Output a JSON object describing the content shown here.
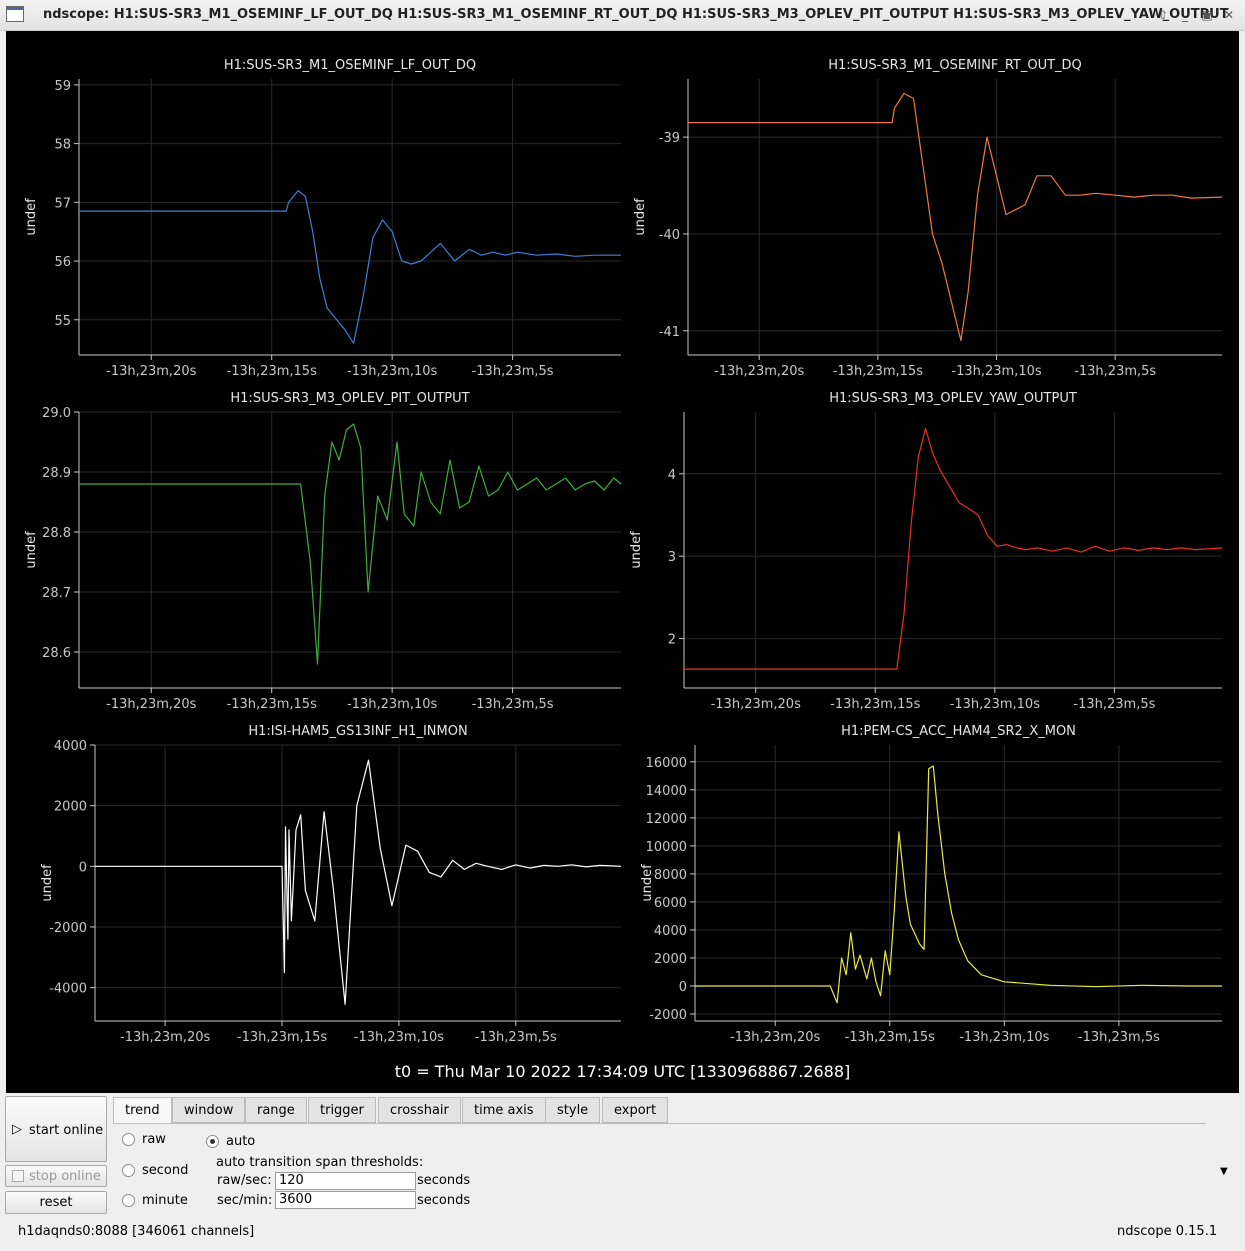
{
  "window": {
    "title": "ndscope: H1:SUS-SR3_M1_OSEMINF_LF_OUT_DQ H1:SUS-SR3_M1_OSEMINF_RT_OUT_DQ H1:SUS-SR3_M3_OPLEV_PIT_OUTPUT H1:SUS-SR3_M3_OPLEV_YAW_OUTPUT",
    "controls": [
      "up-arrow-icon",
      "minimize-icon",
      "maximize-icon",
      "close-icon"
    ]
  },
  "plots": [
    {
      "title": "H1:SUS-SR3_M1_OSEMINF_LF_OUT_DQ",
      "ylabel": "undef",
      "color": "#3f7fd8",
      "yticks": [
        "55",
        "56",
        "57",
        "58",
        "59"
      ],
      "ytick_values": [
        55,
        56,
        57,
        58,
        59
      ],
      "ylim": [
        54.4,
        59.1
      ],
      "xticks": [
        "-13h,23m,20s",
        "-13h,23m,15s",
        "-13h,23m,10s",
        "-13h,23m,5s"
      ]
    },
    {
      "title": "H1:SUS-SR3_M1_OSEMINF_RT_OUT_DQ",
      "ylabel": "undef",
      "color": "#f07a3a",
      "yticks": [
        "-41",
        "-40",
        "-39"
      ],
      "ytick_values": [
        -41,
        -40,
        -39
      ],
      "ylim": [
        -41.25,
        -38.4
      ],
      "xticks": [
        "-13h,23m,20s",
        "-13h,23m,15s",
        "-13h,23m,10s",
        "-13h,23m,5s"
      ]
    },
    {
      "title": "H1:SUS-SR3_M3_OPLEV_PIT_OUTPUT",
      "ylabel": "undef",
      "color": "#3fae3f",
      "yticks": [
        "28.6",
        "28.7",
        "28.8",
        "28.9",
        "29.0"
      ],
      "ytick_values": [
        28.6,
        28.7,
        28.8,
        28.9,
        29.0
      ],
      "ylim": [
        28.54,
        29.0
      ],
      "xticks": [
        "-13h,23m,20s",
        "-13h,23m,15s",
        "-13h,23m,10s",
        "-13h,23m,5s"
      ]
    },
    {
      "title": "H1:SUS-SR3_M3_OPLEV_YAW_OUTPUT",
      "ylabel": "undef",
      "color": "#e8302a",
      "yticks": [
        "2",
        "3",
        "4"
      ],
      "ytick_values": [
        2,
        3,
        4
      ],
      "ylim": [
        1.4,
        4.75
      ],
      "xticks": [
        "-13h,23m,20s",
        "-13h,23m,15s",
        "-13h,23m,10s",
        "-13h,23m,5s"
      ]
    },
    {
      "title": "H1:ISI-HAM5_GS13INF_H1_INMON",
      "ylabel": "undef",
      "color": "#ffffff",
      "yticks": [
        "-4000",
        "-2000",
        "0",
        "2000",
        "4000"
      ],
      "ytick_values": [
        -4000,
        -2000,
        0,
        2000,
        4000
      ],
      "ylim": [
        -5100,
        4000
      ],
      "xticks": [
        "-13h,23m,20s",
        "-13h,23m,15s",
        "-13h,23m,10s",
        "-13h,23m,5s"
      ]
    },
    {
      "title": "H1:PEM-CS_ACC_HAM4_SR2_X_MON",
      "ylabel": "undef",
      "color": "#e8e84a",
      "yticks": [
        "-2000",
        "0",
        "2000",
        "4000",
        "6000",
        "8000",
        "10000",
        "12000",
        "14000",
        "16000"
      ],
      "ytick_values": [
        -2000,
        0,
        2000,
        4000,
        6000,
        8000,
        10000,
        12000,
        14000,
        16000
      ],
      "ylim": [
        -2500,
        17200
      ],
      "xticks": [
        "-13h,23m,20s",
        "-13h,23m,15s",
        "-13h,23m,10s",
        "-13h,23m,5s"
      ]
    }
  ],
  "chart_data": [
    {
      "type": "line",
      "title": "H1:SUS-SR3_M1_OSEMINF_LF_OUT_DQ",
      "ylabel": "undef",
      "xlim": [
        -23.0,
        -0.5
      ],
      "ylim": [
        54.4,
        59.1
      ],
      "series": [
        {
          "values_x": [
            -23,
            -14.4,
            -14.3,
            -13.9,
            -13.6,
            -13.3,
            -13.0,
            -12.7,
            -12.4,
            -12.0,
            -11.6,
            -11.2,
            -10.8,
            -10.4,
            -10.0,
            -9.6,
            -9.2,
            -8.8,
            -8.4,
            -8.0,
            -7.4,
            -6.8,
            -6.3,
            -5.8,
            -5.3,
            -4.8,
            -4.0,
            -3.2,
            -2.4,
            -1.6,
            -0.5
          ],
          "values_y": [
            56.85,
            56.85,
            57.0,
            57.2,
            57.1,
            56.5,
            55.7,
            55.2,
            55.05,
            54.85,
            54.6,
            55.4,
            56.4,
            56.7,
            56.5,
            56.0,
            55.95,
            56.0,
            56.15,
            56.3,
            56.0,
            56.2,
            56.1,
            56.15,
            56.1,
            56.15,
            56.1,
            56.12,
            56.08,
            56.1,
            56.1
          ]
        }
      ]
    },
    {
      "type": "line",
      "title": "H1:SUS-SR3_M1_OSEMINF_RT_OUT_DQ",
      "ylabel": "undef",
      "xlim": [
        -23.0,
        -0.5
      ],
      "ylim": [
        -41.25,
        -38.4
      ],
      "series": [
        {
          "values_x": [
            -23,
            -14.4,
            -14.3,
            -13.9,
            -13.5,
            -13.1,
            -12.7,
            -12.3,
            -11.9,
            -11.5,
            -11.2,
            -10.8,
            -10.4,
            -10.0,
            -9.6,
            -9.2,
            -8.8,
            -8.3,
            -7.7,
            -7.1,
            -6.5,
            -5.8,
            -5.0,
            -4.2,
            -3.4,
            -2.6,
            -1.8,
            -0.5
          ],
          "values_y": [
            -38.85,
            -38.85,
            -38.7,
            -38.55,
            -38.6,
            -39.3,
            -40.0,
            -40.3,
            -40.7,
            -41.1,
            -40.6,
            -39.6,
            -39.0,
            -39.4,
            -39.8,
            -39.75,
            -39.7,
            -39.4,
            -39.4,
            -39.6,
            -39.6,
            -39.58,
            -39.6,
            -39.62,
            -39.6,
            -39.6,
            -39.63,
            -39.62
          ]
        }
      ]
    },
    {
      "type": "line",
      "title": "H1:SUS-SR3_M3_OPLEV_PIT_OUTPUT",
      "ylabel": "undef",
      "xlim": [
        -23.0,
        -0.5
      ],
      "ylim": [
        28.54,
        29.0
      ],
      "series": [
        {
          "values_x": [
            -23,
            -13.8,
            -13.4,
            -13.1,
            -12.8,
            -12.5,
            -12.2,
            -11.9,
            -11.6,
            -11.3,
            -11.0,
            -10.6,
            -10.2,
            -9.8,
            -9.5,
            -9.1,
            -8.8,
            -8.4,
            -8.0,
            -7.6,
            -7.2,
            -6.8,
            -6.4,
            -6.0,
            -5.6,
            -5.2,
            -4.8,
            -4.4,
            -4.0,
            -3.6,
            -3.2,
            -2.8,
            -2.4,
            -2.0,
            -1.6,
            -1.2,
            -0.8,
            -0.5
          ],
          "values_y": [
            28.88,
            28.88,
            28.75,
            28.58,
            28.86,
            28.95,
            28.92,
            28.97,
            28.98,
            28.94,
            28.7,
            28.86,
            28.82,
            28.95,
            28.83,
            28.81,
            28.9,
            28.85,
            28.83,
            28.92,
            28.84,
            28.85,
            28.91,
            28.86,
            28.87,
            28.9,
            28.87,
            28.88,
            28.89,
            28.87,
            28.88,
            28.89,
            28.87,
            28.88,
            28.885,
            28.87,
            28.89,
            28.88
          ]
        }
      ]
    },
    {
      "type": "line",
      "title": "H1:SUS-SR3_M3_OPLEV_YAW_OUTPUT",
      "ylabel": "undef",
      "xlim": [
        -23.0,
        -0.5
      ],
      "ylim": [
        1.4,
        4.75
      ],
      "series": [
        {
          "values_x": [
            -23,
            -14.1,
            -13.8,
            -13.5,
            -13.2,
            -12.9,
            -12.6,
            -12.3,
            -11.9,
            -11.5,
            -11.1,
            -10.7,
            -10.3,
            -9.9,
            -9.5,
            -9.1,
            -8.7,
            -8.2,
            -7.6,
            -7.0,
            -6.4,
            -5.8,
            -5.2,
            -4.6,
            -4.0,
            -3.4,
            -2.8,
            -2.2,
            -1.6,
            -0.5
          ],
          "values_y": [
            1.63,
            1.63,
            2.3,
            3.4,
            4.2,
            4.55,
            4.25,
            4.05,
            3.85,
            3.65,
            3.58,
            3.5,
            3.25,
            3.12,
            3.14,
            3.1,
            3.08,
            3.1,
            3.06,
            3.1,
            3.05,
            3.12,
            3.06,
            3.1,
            3.07,
            3.1,
            3.08,
            3.1,
            3.08,
            3.1
          ]
        }
      ]
    },
    {
      "type": "line",
      "title": "H1:ISI-HAM5_GS13INF_H1_INMON",
      "ylabel": "undef",
      "xlim": [
        -23.0,
        -0.5
      ],
      "ylim": [
        -5100,
        4000
      ],
      "series": [
        {
          "values_x": [
            -23,
            -15.0,
            -14.9,
            -14.85,
            -14.75,
            -14.7,
            -14.6,
            -14.4,
            -14.2,
            -14.0,
            -13.6,
            -13.2,
            -12.8,
            -12.3,
            -11.8,
            -11.3,
            -10.8,
            -10.3,
            -9.7,
            -9.2,
            -8.7,
            -8.2,
            -7.7,
            -7.2,
            -6.7,
            -6.2,
            -5.6,
            -5.0,
            -4.4,
            -3.8,
            -3.2,
            -2.6,
            -2.0,
            -1.4,
            -0.5
          ],
          "values_y": [
            0,
            0,
            -3500,
            1300,
            -2400,
            1200,
            -1800,
            1200,
            1700,
            -800,
            -1800,
            1800,
            -800,
            -4550,
            2000,
            3500,
            600,
            -1300,
            700,
            500,
            -200,
            -350,
            200,
            -100,
            100,
            0,
            -100,
            50,
            -60,
            30,
            0,
            50,
            -20,
            30,
            0
          ]
        }
      ]
    },
    {
      "type": "line",
      "title": "H1:PEM-CS_ACC_HAM4_SR2_X_MON",
      "ylabel": "undef",
      "xlim": [
        -23.5,
        -0.5
      ],
      "ylim": [
        -2500,
        17200
      ],
      "series": [
        {
          "values_x": [
            -23.5,
            -20,
            -17.6,
            -17.3,
            -17.1,
            -16.9,
            -16.7,
            -16.5,
            -16.3,
            -16.0,
            -15.8,
            -15.6,
            -15.4,
            -15.2,
            -15.0,
            -14.8,
            -14.6,
            -14.3,
            -14.1,
            -13.9,
            -13.7,
            -13.5,
            -13.3,
            -13.1,
            -12.9,
            -12.6,
            -12.3,
            -12.0,
            -11.6,
            -11.0,
            -10.0,
            -8.0,
            -6.0,
            -4.0,
            -2.0,
            -0.5
          ],
          "values_y": [
            0,
            0,
            0,
            -1200,
            2000,
            800,
            3800,
            1200,
            2200,
            500,
            2000,
            300,
            -700,
            2500,
            800,
            5400,
            11000,
            6400,
            4400,
            3700,
            3000,
            2600,
            15500,
            15700,
            12200,
            8000,
            5200,
            3300,
            1800,
            800,
            300,
            50,
            -50,
            50,
            0,
            0
          ]
        }
      ]
    }
  ],
  "t0": "t0 = Thu Mar 10 2022 17:34:09 UTC [1330968867.2688]",
  "buttons": {
    "start_online": "start online",
    "stop_online": "stop online",
    "reset": "reset",
    "start_icon": "play-icon"
  },
  "tabs": [
    "trend",
    "window",
    "range",
    "trigger",
    "crosshair",
    "time axis",
    "style",
    "export"
  ],
  "active_tab": "trend",
  "trend": {
    "radios": [
      "raw",
      "second",
      "minute"
    ],
    "auto_label": "auto",
    "auto_checked": true,
    "thresholds_label": "auto transition span thresholds:",
    "raw_sec_label": "raw/sec:",
    "raw_sec_value": "120",
    "sec_min_label": "sec/min:",
    "sec_min_value": "3600",
    "unit": "seconds"
  },
  "status": {
    "server": "h1daqnds0:8088  [346061 channels]",
    "version": "ndscope 0.15.1"
  }
}
